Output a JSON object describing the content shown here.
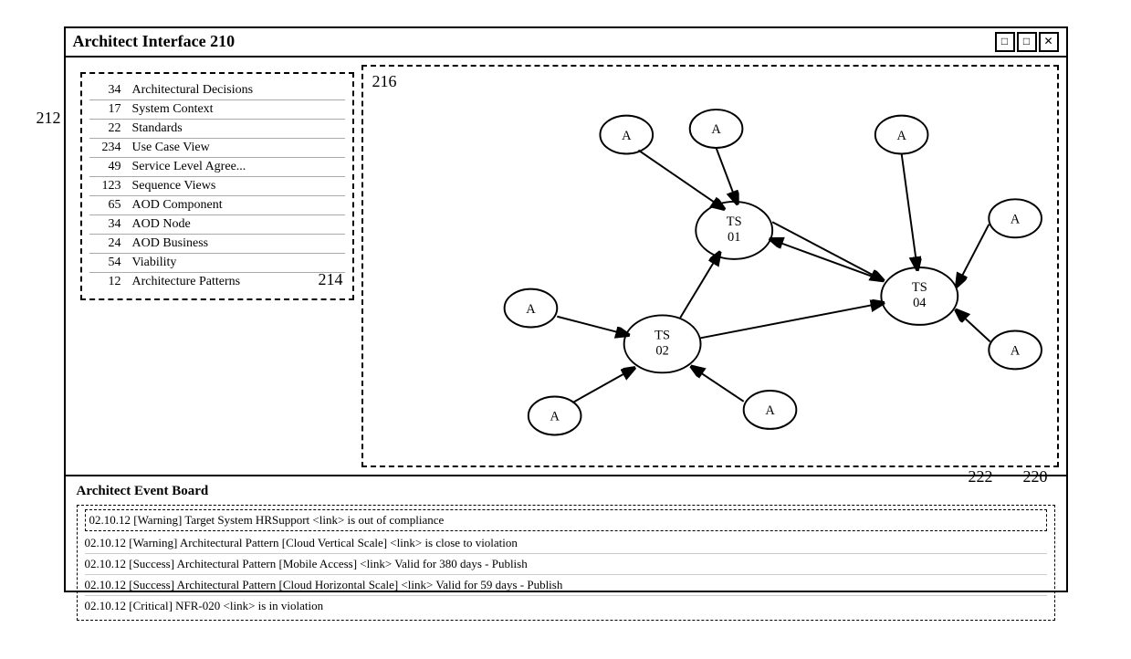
{
  "window": {
    "title": "Architect Interface 210",
    "controls": [
      "□",
      "□",
      "✕"
    ]
  },
  "labels": {
    "l212": "212",
    "l214": "214",
    "l216": "216",
    "l220": "220",
    "l222": "222"
  },
  "list": {
    "items": [
      {
        "num": "34",
        "label": "Architectural Decisions"
      },
      {
        "num": "17",
        "label": "System Context"
      },
      {
        "num": "22",
        "label": "Standards"
      },
      {
        "num": "234",
        "label": "Use Case View"
      },
      {
        "num": "49",
        "label": "Service Level Agree..."
      },
      {
        "num": "123",
        "label": "Sequence Views"
      },
      {
        "num": "65",
        "label": "AOD Component"
      },
      {
        "num": "34",
        "label": "AOD Node"
      },
      {
        "num": "24",
        "label": "AOD Business"
      },
      {
        "num": "54",
        "label": "Viability"
      },
      {
        "num": "12",
        "label": "Architecture Patterns"
      }
    ]
  },
  "eventBoard": {
    "title": "Architect Event Board",
    "events": [
      "02.10.12 [Warning] Target System HRSupport <link> is out of compliance",
      "02.10.12 [Warning] Architectural Pattern [Cloud Vertical Scale] <link> is close to violation",
      "02.10.12 [Success] Architectural Pattern [Mobile Access] <link> Valid for 380 days - Publish",
      "02.10.12 [Success] Architectural Pattern [Cloud Horizontal Scale] <link> Valid for 59 days - Publish",
      "02.10.12 [Critical] NFR-020 <link> is in violation"
    ]
  }
}
